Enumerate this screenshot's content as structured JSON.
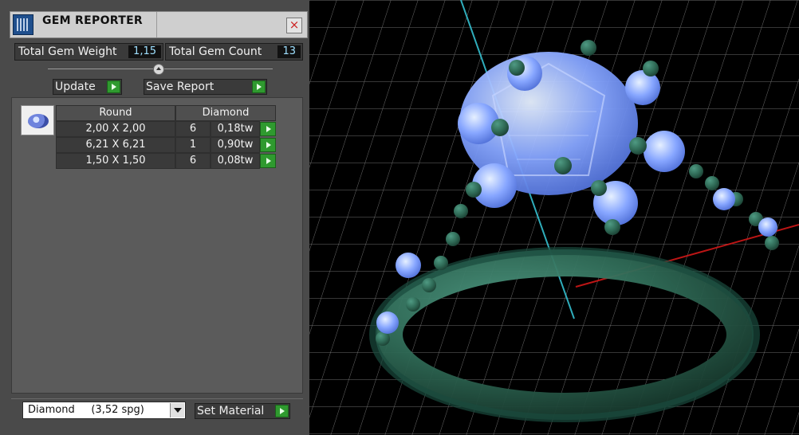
{
  "window": {
    "title": "GEM REPORTER",
    "close_glyph": "×"
  },
  "stats": {
    "total_gem_weight_label": "Total Gem Weight",
    "total_gem_weight": "1,15",
    "total_gem_count_label": "Total Gem Count",
    "total_gem_count": "13"
  },
  "actions": {
    "update_label": "Update",
    "save_report_label": "Save Report",
    "set_material_label": "Set Material"
  },
  "gem_table": {
    "headers": {
      "shape": "Round",
      "material": "Diamond"
    },
    "rows": [
      {
        "size": "2,00 X 2,00",
        "count": "6",
        "weight": "0,18tw"
      },
      {
        "size": "6,21 X 6,21",
        "count": "1",
        "weight": "0,90tw"
      },
      {
        "size": "1,50 X 1,50",
        "count": "6",
        "weight": "0,08tw"
      }
    ]
  },
  "material_select": {
    "selected": "Diamond     (3,52 spg)"
  },
  "icons": {
    "app": "gem-reporter-app-icon",
    "close": "close-icon",
    "thumbnail": "round-gem-icon",
    "play": "play-arrow-icon"
  },
  "colors": {
    "accent_green": "#2f9a2f",
    "value_text": "#9fe0ff",
    "ring_metal": "#2f6a56",
    "gem_blue": "#87a6ff",
    "grid": "#7a7a7a"
  }
}
